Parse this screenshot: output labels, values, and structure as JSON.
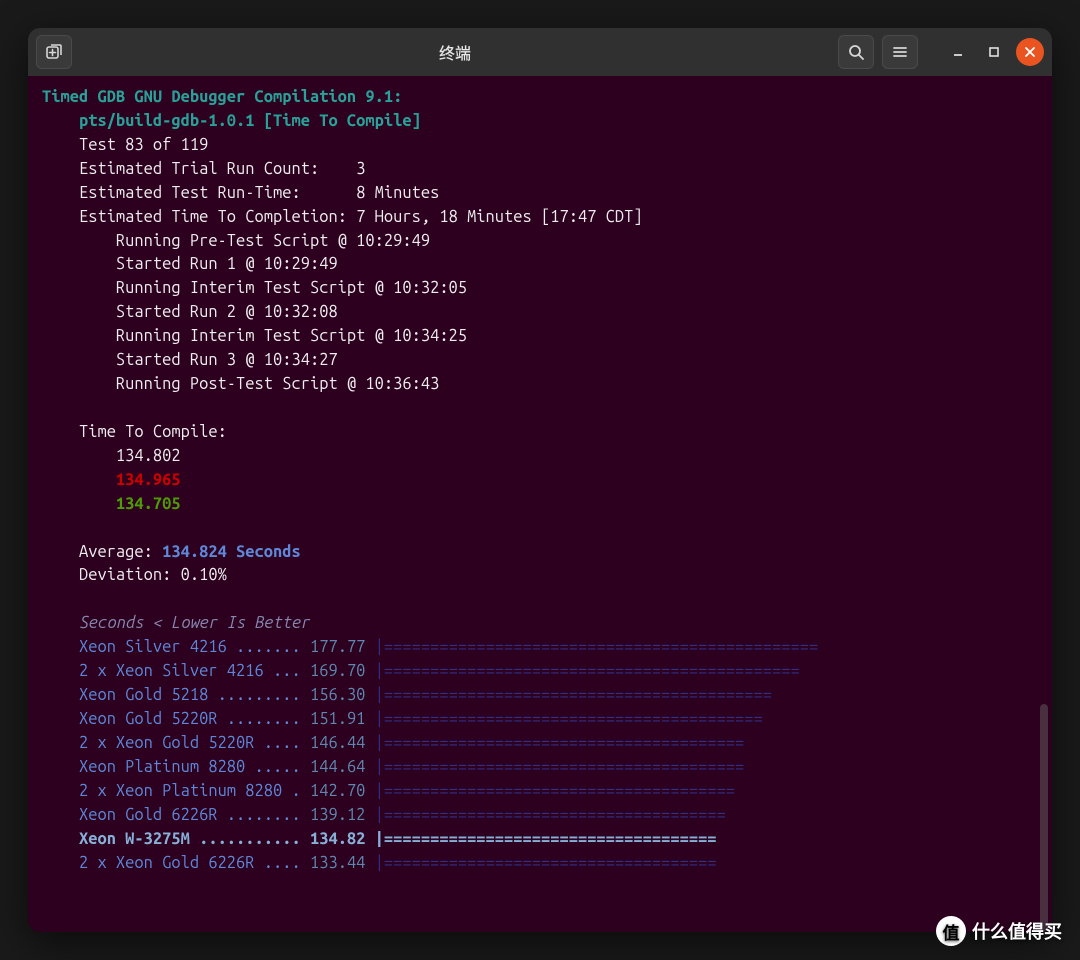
{
  "window": {
    "title": "终端",
    "icons": {
      "new_tab": "new-tab-icon",
      "search": "search-icon",
      "menu": "hamburger-icon",
      "minimize": "minimize-icon",
      "maximize": "maximize-icon",
      "close": "close-icon"
    }
  },
  "header": {
    "title": "Timed GDB GNU Debugger Compilation 9.1:",
    "subtitle": "pts/build-gdb-1.0.1 [Time To Compile]"
  },
  "info": {
    "test_progress": "Test 83 of 119",
    "trial_count_label": "Estimated Trial Run Count:",
    "trial_count_value": "3",
    "runtime_label": "Estimated Test Run-Time:",
    "runtime_value": "8 Minutes",
    "completion_label": "Estimated Time To Completion:",
    "completion_value": "7 Hours, 18 Minutes [17:47 CDT]"
  },
  "log": [
    "Running Pre-Test Script @ 10:29:49",
    "Started Run 1 @ 10:29:49",
    "Running Interim Test Script @ 10:32:05",
    "Started Run 2 @ 10:32:08",
    "Running Interim Test Script @ 10:34:25",
    "Started Run 3 @ 10:34:27",
    "Running Post-Test Script @ 10:36:43"
  ],
  "results": {
    "section_label": "Time To Compile:",
    "normal": "134.802",
    "max": "134.965",
    "min": "134.705",
    "average_label": "Average:",
    "average_value": "134.824 Seconds",
    "deviation_label": "Deviation:",
    "deviation_value": "0.10%"
  },
  "comparison": {
    "header": "Seconds < Lower Is Better",
    "rows": [
      {
        "label": "Xeon Silver 4216 ....... ",
        "value": "177.77",
        "bar": "|===============================================",
        "hl": false
      },
      {
        "label": "2 x Xeon Silver 4216 ... ",
        "value": "169.70",
        "bar": "|=============================================",
        "hl": false
      },
      {
        "label": "Xeon Gold 5218 ......... ",
        "value": "156.30",
        "bar": "|==========================================",
        "hl": false
      },
      {
        "label": "Xeon Gold 5220R ........ ",
        "value": "151.91",
        "bar": "|=========================================",
        "hl": false
      },
      {
        "label": "2 x Xeon Gold 5220R .... ",
        "value": "146.44",
        "bar": "|=======================================",
        "hl": false
      },
      {
        "label": "Xeon Platinum 8280 ..... ",
        "value": "144.64",
        "bar": "|=======================================",
        "hl": false
      },
      {
        "label": "2 x Xeon Platinum 8280 . ",
        "value": "142.70",
        "bar": "|======================================",
        "hl": false
      },
      {
        "label": "Xeon Gold 6226R ........ ",
        "value": "139.12",
        "bar": "|=====================================",
        "hl": false
      },
      {
        "label": "Xeon W-3275M ........... ",
        "value": "134.82",
        "bar": "|====================================",
        "hl": true
      },
      {
        "label": "2 x Xeon Gold 6226R .... ",
        "value": "133.44",
        "bar": "|====================================",
        "hl": false
      }
    ]
  },
  "chart_data": {
    "type": "bar",
    "title": "Timed GDB GNU Debugger Compilation 9.1 — Time To Compile",
    "xlabel": "",
    "ylabel": "Seconds (Lower Is Better)",
    "categories": [
      "Xeon Silver 4216",
      "2 x Xeon Silver 4216",
      "Xeon Gold 5218",
      "Xeon Gold 5220R",
      "2 x Xeon Gold 5220R",
      "Xeon Platinum 8280",
      "2 x Xeon Platinum 8280",
      "Xeon Gold 6226R",
      "Xeon W-3275M",
      "2 x Xeon Gold 6226R"
    ],
    "values": [
      177.77,
      169.7,
      156.3,
      151.91,
      146.44,
      144.64,
      142.7,
      139.12,
      134.82,
      133.44
    ]
  },
  "watermark": "什么值得买"
}
